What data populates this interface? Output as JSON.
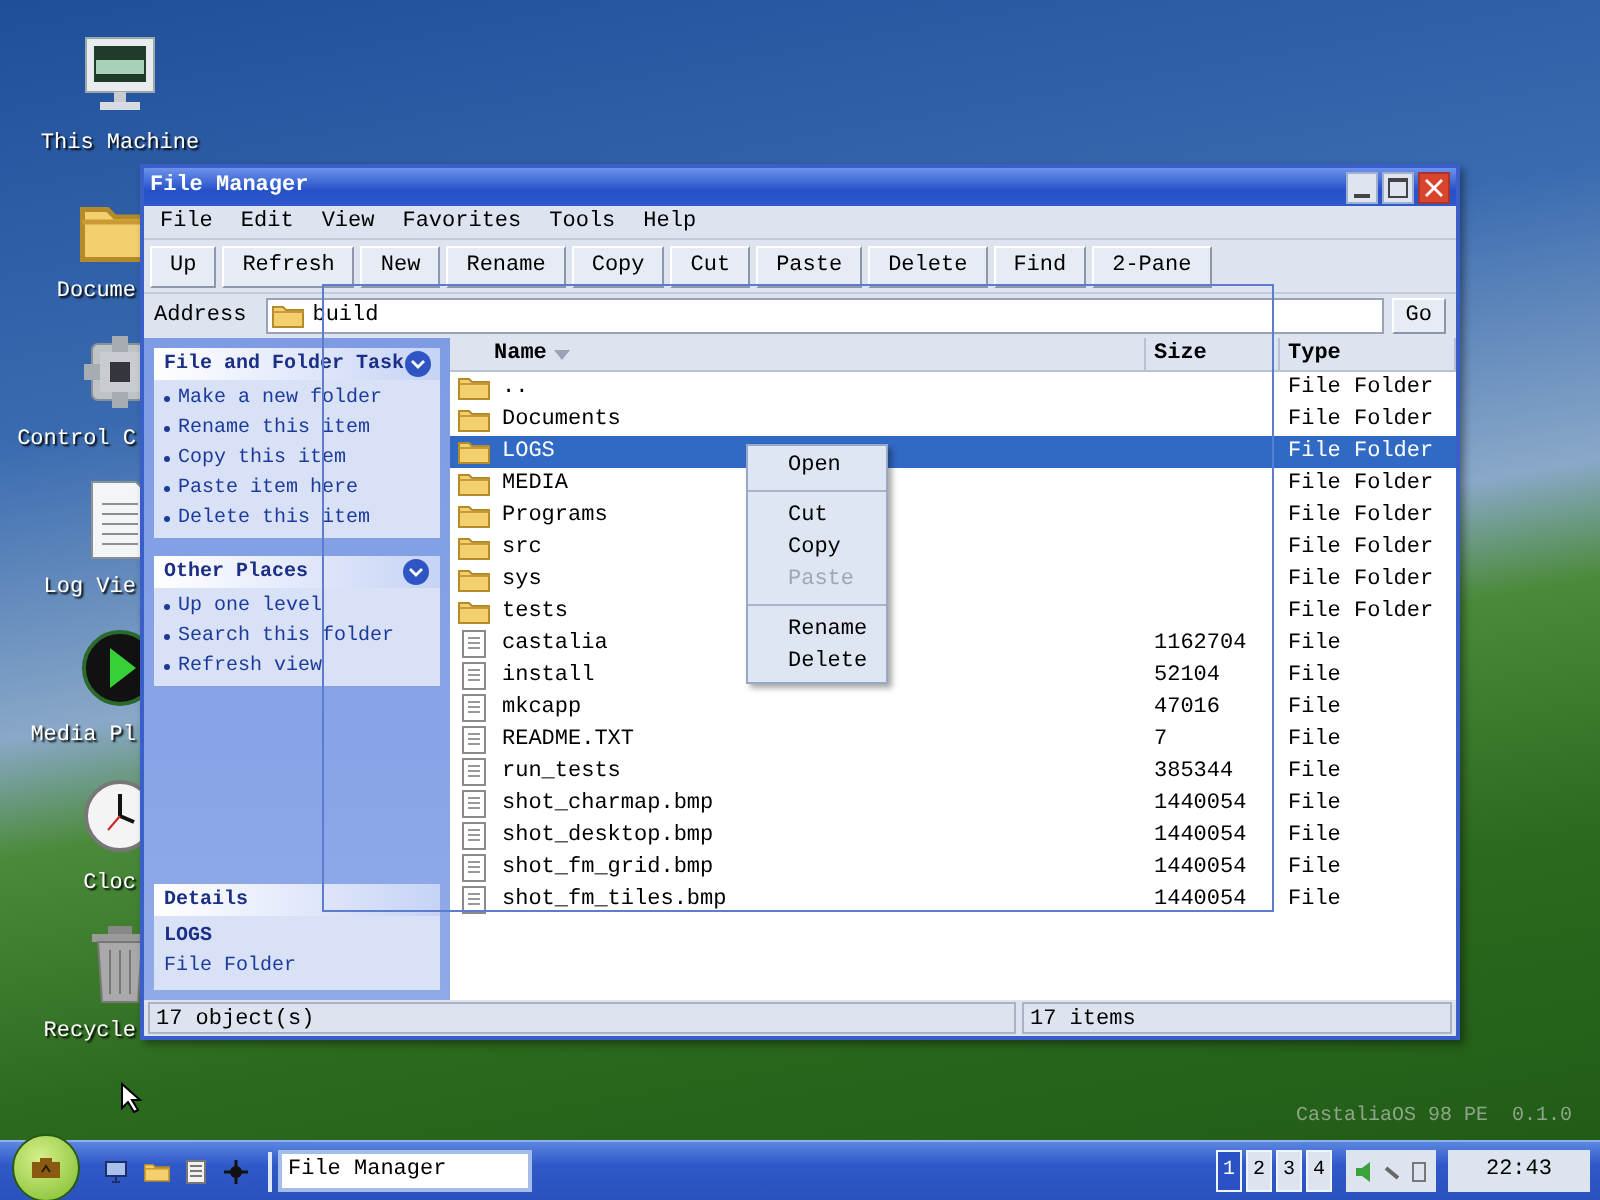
{
  "desktop_icons": [
    {
      "kind": "computer",
      "label": "This Machine",
      "cut": false
    },
    {
      "kind": "folder",
      "label": "Docume",
      "cut": true
    },
    {
      "kind": "control",
      "label": "Control C",
      "cut": true
    },
    {
      "kind": "document",
      "label": "Log Vie",
      "cut": true
    },
    {
      "kind": "media",
      "label": "Media Pl",
      "cut": true
    },
    {
      "kind": "clock",
      "label": "Cloc",
      "cut": true
    },
    {
      "kind": "trash",
      "label": "Recycle",
      "cut": true
    }
  ],
  "window": {
    "title": "File Manager",
    "menu": [
      "File",
      "Edit",
      "View",
      "Favorites",
      "Tools",
      "Help"
    ],
    "toolbar": [
      "Up",
      "Refresh",
      "New",
      "Rename",
      "Copy",
      "Cut",
      "Paste",
      "Delete",
      "Find",
      "2-Pane"
    ],
    "address": {
      "label": "Address",
      "value": "build",
      "button": "Go"
    },
    "sidebar": {
      "panels": [
        {
          "title": "File and Folder Task",
          "expanded": true,
          "items": [
            "Make a new folder",
            "Rename this item",
            "Copy this item",
            "Paste item here",
            "Delete this item"
          ]
        },
        {
          "title": "Other Places",
          "expanded": true,
          "items": [
            "Up one level",
            "Search this folder",
            "Refresh view"
          ]
        }
      ],
      "details": {
        "title": "Details",
        "name": "LOGS",
        "type": "File Folder"
      }
    },
    "file_list": {
      "columns": [
        {
          "label": "Name",
          "sorted": true
        },
        {
          "label": "Size",
          "sorted": false
        },
        {
          "label": "Type",
          "sorted": false
        }
      ],
      "rows": [
        {
          "kind": "folder",
          "name": "..",
          "type": "File Folder",
          "selected": false
        },
        {
          "kind": "folder",
          "name": "Documents",
          "type": "File Folder",
          "selected": false
        },
        {
          "kind": "folder",
          "name": "LOGS",
          "type": "File Folder",
          "selected": true
        },
        {
          "kind": "folder",
          "name": "MEDIA",
          "type": "File Folder",
          "selected": false
        },
        {
          "kind": "folder",
          "name": "Programs",
          "type": "File Folder",
          "selected": false
        },
        {
          "kind": "folder",
          "name": "src",
          "type": "File Folder",
          "selected": false
        },
        {
          "kind": "folder",
          "name": "sys",
          "type": "File Folder",
          "selected": false
        },
        {
          "kind": "folder",
          "name": "tests",
          "type": "File Folder",
          "selected": false
        },
        {
          "kind": "file",
          "name": "castalia",
          "size": "1162704",
          "type": "File",
          "selected": false
        },
        {
          "kind": "file",
          "name": "install",
          "size": "52104",
          "type": "File",
          "selected": false
        },
        {
          "kind": "file",
          "name": "mkcapp",
          "size": "47016",
          "type": "File",
          "selected": false
        },
        {
          "kind": "file",
          "name": "README.TXT",
          "size": "7",
          "type": "File",
          "selected": false
        },
        {
          "kind": "file",
          "name": "run_tests",
          "size": "385344",
          "type": "File",
          "selected": false
        },
        {
          "kind": "file",
          "name": "shot_charmap.bmp",
          "size": "1440054",
          "type": "File",
          "selected": false
        },
        {
          "kind": "file",
          "name": "shot_desktop.bmp",
          "size": "1440054",
          "type": "File",
          "selected": false
        },
        {
          "kind": "file",
          "name": "shot_fm_grid.bmp",
          "size": "1440054",
          "type": "File",
          "selected": false
        },
        {
          "kind": "file",
          "name": "shot_fm_tiles.bmp",
          "size": "1440054",
          "type": "File",
          "selected": false
        }
      ]
    },
    "status_bar": [
      "17 object(s)",
      "17 items"
    ]
  },
  "context_menu": [
    {
      "kind": "item",
      "label": "Open",
      "disabled": false
    },
    {
      "kind": "separator"
    },
    {
      "kind": "item",
      "label": "Cut",
      "disabled": false
    },
    {
      "kind": "item",
      "label": "Copy",
      "disabled": false
    },
    {
      "kind": "item",
      "label": "Paste",
      "disabled": true
    },
    {
      "kind": "separator"
    },
    {
      "kind": "item",
      "label": "Rename",
      "disabled": false
    },
    {
      "kind": "item",
      "label": "Delete",
      "disabled": false
    }
  ],
  "version_text": "CastaliaOS 98 PE  0.1.0",
  "taskbar": {
    "quick_launch": [
      {
        "kind": "monitor"
      },
      {
        "kind": "folder"
      },
      {
        "kind": "document"
      },
      {
        "kind": "star"
      }
    ],
    "task_button": "File Manager",
    "workspaces": [
      {
        "label": "1",
        "selected": true
      },
      {
        "label": "2",
        "selected": false
      },
      {
        "label": "3",
        "selected": false
      },
      {
        "label": "4",
        "selected": false
      }
    ],
    "clock": "22:43"
  }
}
